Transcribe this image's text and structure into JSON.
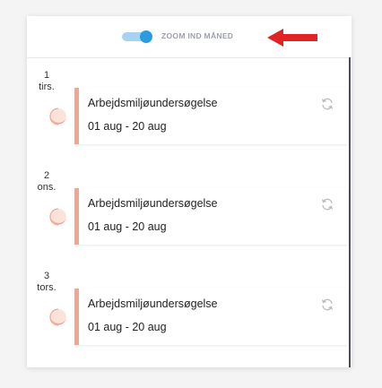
{
  "header": {
    "toggle_label": "ZOOM IND MÅNED",
    "toggle_on": true
  },
  "colors": {
    "toggle_knob": "#2b9be0",
    "toggle_track": "#a7d3ee",
    "event_accent": "#f2a68f",
    "annotation_arrow": "#e02424"
  },
  "days": [
    {
      "day_number": "1",
      "weekday": "tirs.",
      "event": {
        "title": "Arbejdsmiljøundersøgelse",
        "dates": "01 aug - 20 aug",
        "icon": "repeat-icon"
      }
    },
    {
      "day_number": "2",
      "weekday": "ons.",
      "event": {
        "title": "Arbejdsmiljøundersøgelse",
        "dates": "01 aug - 20 aug",
        "icon": "repeat-icon"
      }
    },
    {
      "day_number": "3",
      "weekday": "tors.",
      "event": {
        "title": "Arbejdsmiljøundersøgelse",
        "dates": "01 aug - 20 aug",
        "icon": "repeat-icon"
      }
    }
  ]
}
